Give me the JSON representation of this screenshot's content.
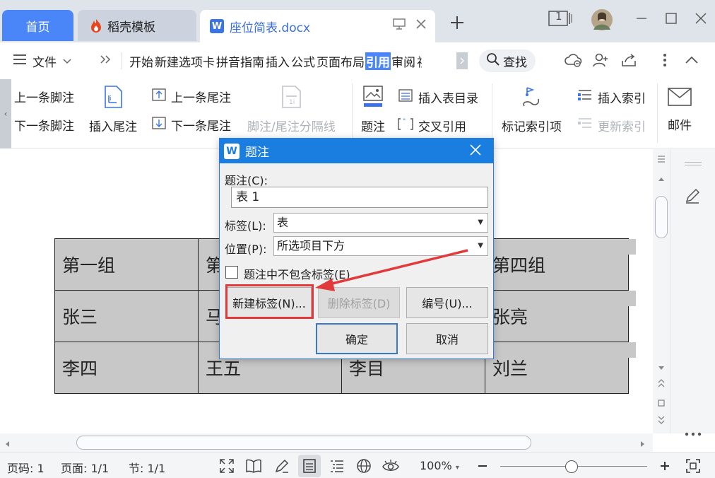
{
  "tabs": {
    "home": "首页",
    "template": "稻壳模板",
    "document": "座位简表.docx",
    "page_badge": "1"
  },
  "menu": {
    "file": "文件",
    "items": [
      "开始",
      "新建选项卡",
      "拼音指南",
      "插入",
      "公式",
      "页面布局",
      "引用",
      "审阅",
      "视"
    ],
    "active_index": 6,
    "search": "查找"
  },
  "ribbon": {
    "prev_footnote": "上一条脚注",
    "next_footnote": "下一条脚注",
    "insert_endnote": "插入尾注",
    "prev_endnote": "上一条尾注",
    "next_endnote": "下一条尾注",
    "separator": "脚注/尾注分隔线",
    "caption": "题注",
    "insert_toc": "插入表目录",
    "cross_ref": "交叉引用",
    "mark_entry": "标记索引项",
    "insert_index": "插入索引",
    "update_index": "更新索引",
    "mail": "邮件"
  },
  "table": {
    "rows": [
      [
        "第一组",
        "第",
        "",
        "第四组"
      ],
      [
        "张三",
        "马",
        "",
        "张亮"
      ],
      [
        "李四",
        "王五",
        "李目",
        "刘兰"
      ]
    ]
  },
  "dialog": {
    "title": "题注",
    "caption_label": "题注(C):",
    "caption_value": "表 1",
    "tag_label": "标签(L):",
    "tag_value": "表",
    "position_label": "位置(P):",
    "position_value": "所选项目下方",
    "exclude_label": "题注中不包含标签(E)",
    "new_tag": "新建标签(N)...",
    "delete_tag": "删除标签(D)",
    "numbering": "编号(U)...",
    "ok": "确定",
    "cancel": "取消"
  },
  "status": {
    "page_no": "页码: 1",
    "pages": "页面: 1/1",
    "section": "节: 1/1",
    "zoom": "100%"
  },
  "colors": {
    "accent": "#4a86f7",
    "dialog_title": "#1a7ee0",
    "annotation": "#e23a3a"
  }
}
